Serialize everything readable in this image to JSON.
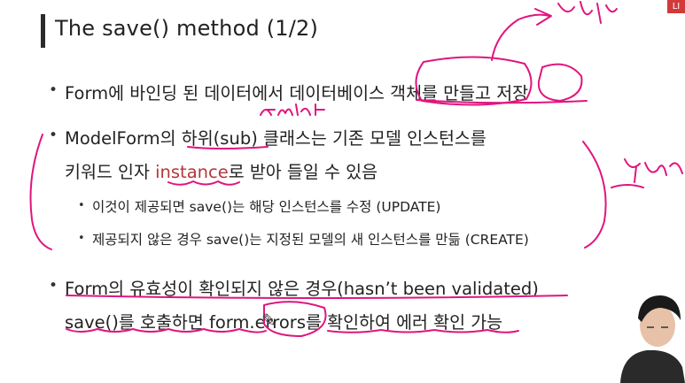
{
  "slide": {
    "title": "The save() method (1/2)",
    "bullet1": "Form에 바인딩 된 데이터에서 데이터베이스 객체를 만들고 저장",
    "bullet2_part1": "ModelForm의 하위(sub) 클래스는 기존 모델 인스턴스를",
    "bullet2_part2a": "키워드 인자 ",
    "bullet2_keyword": "instance",
    "bullet2_part2b": "로 받아 들일 수 있음",
    "sub1": "이것이 제공되면 save()는 해당 인스턴스를 수정 (UPDATE)",
    "sub2": "제공되지 않은 경우 save()는 지정된 모델의 새 인스턴스를 만듦 (CREATE)",
    "bullet3_part1": "Form의 유효성이 확인되지 않은 경우(hasn’t been validated)",
    "bullet3_part2": "save()를 호출하면 form.errors를 확인하여 에러 확인 가능",
    "bullet_char": "•",
    "badge": "LI"
  },
  "annotations": {
    "handwriting_top": "만들",
    "handwriting_right": "수정",
    "handwriting_small": "ArticleForm",
    "ink_color": "#e0157e"
  }
}
